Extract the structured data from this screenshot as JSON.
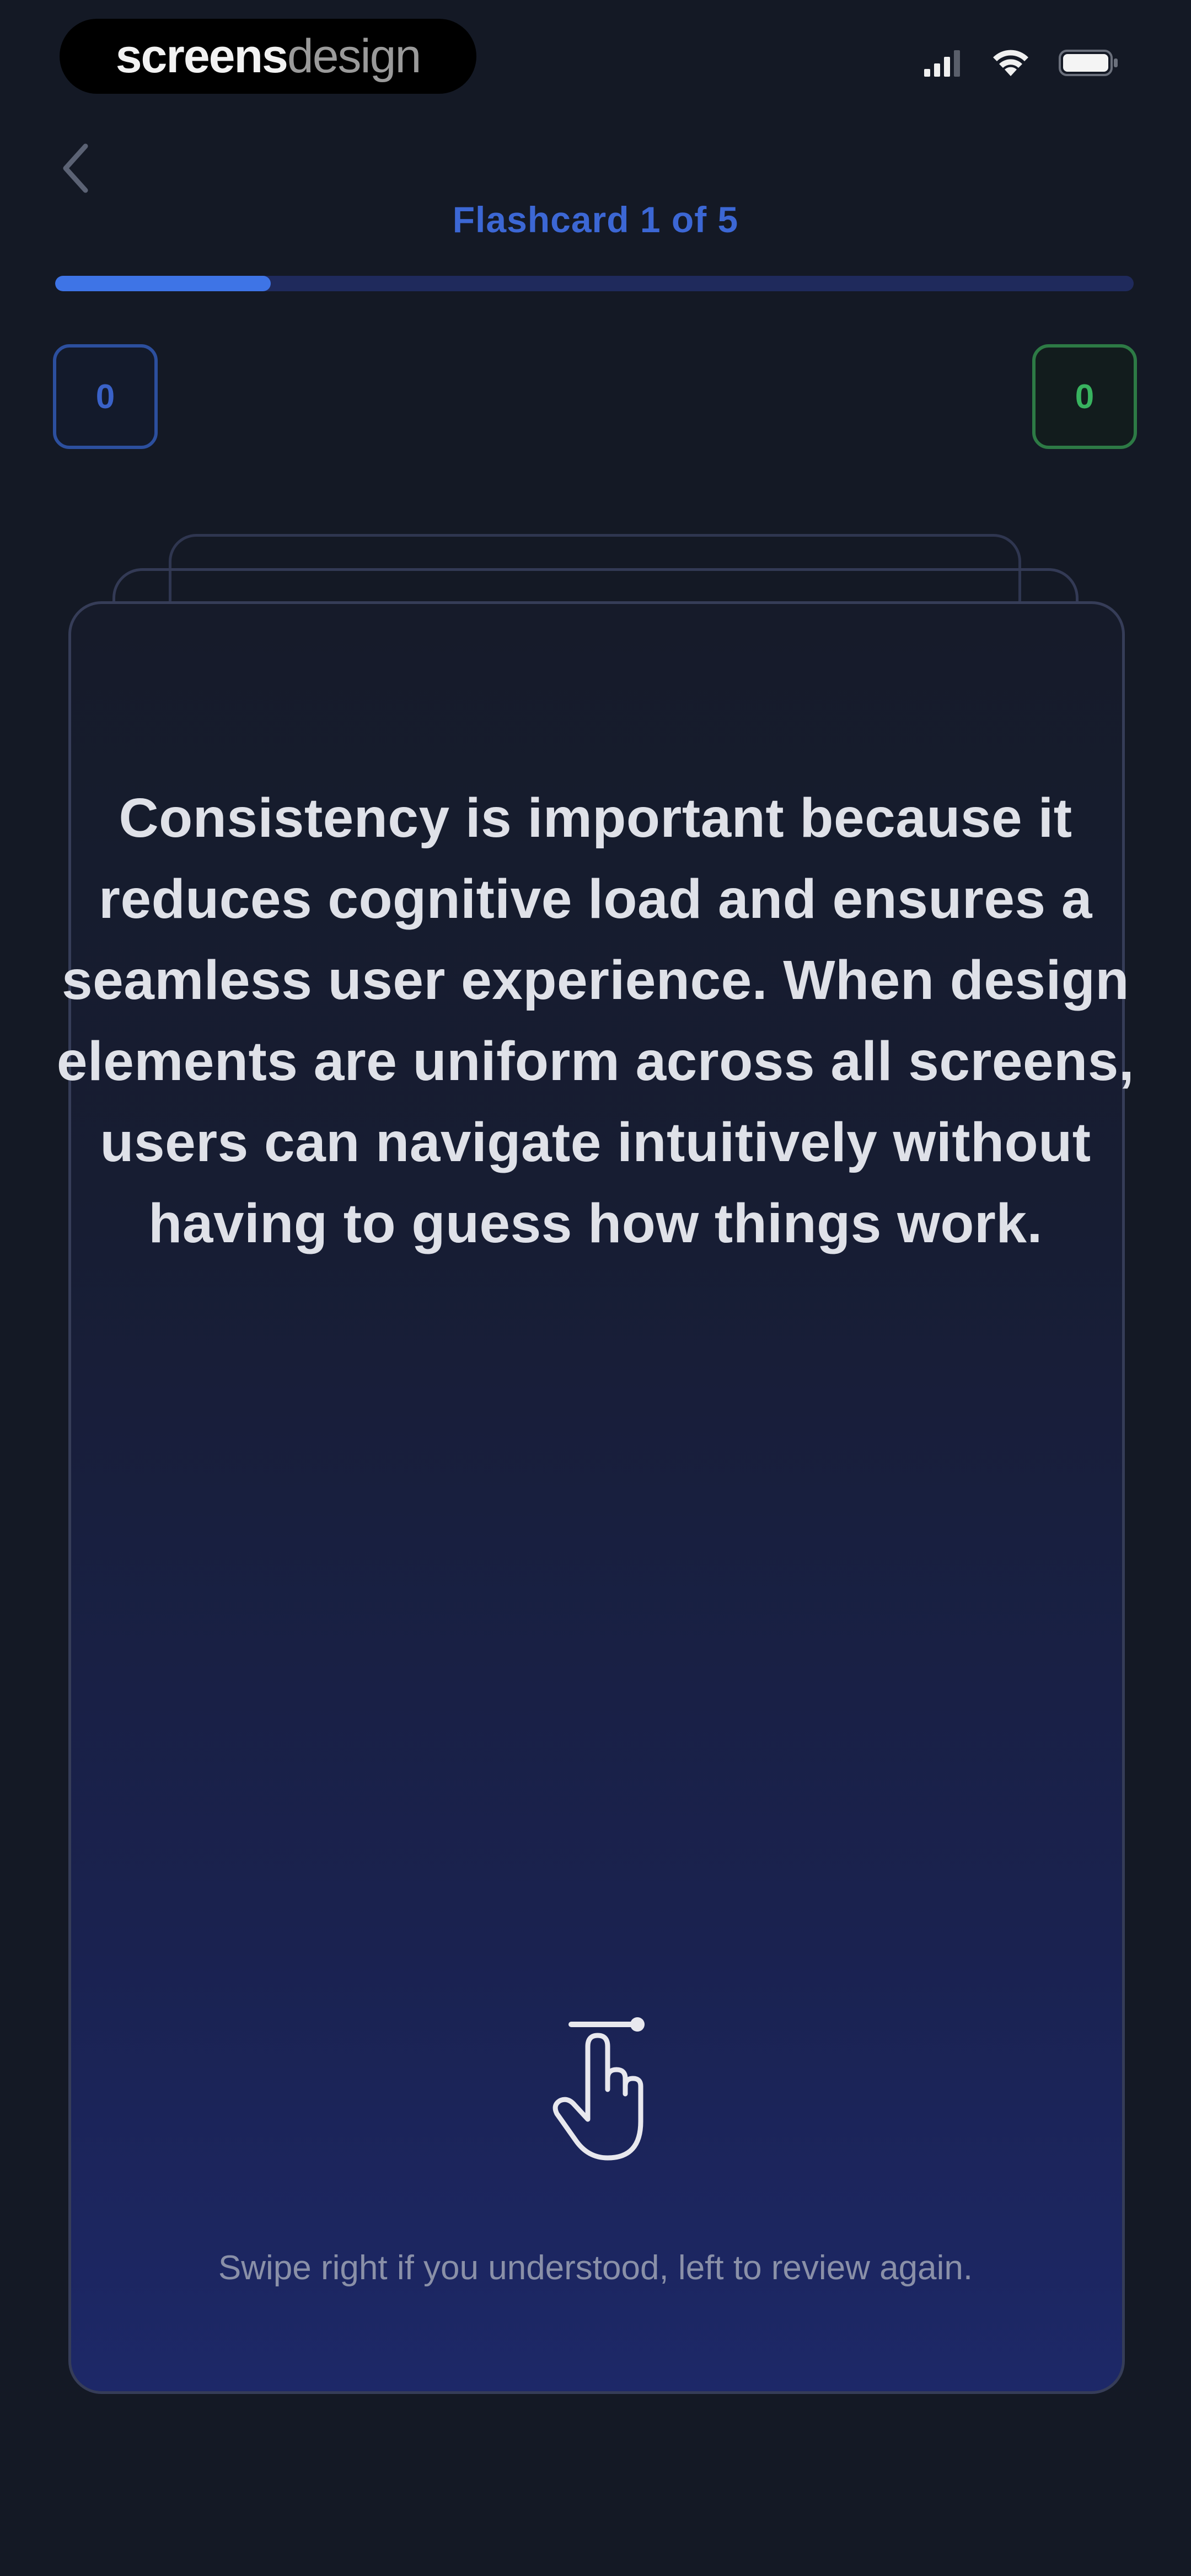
{
  "status_bar": {
    "brand_strong": "screens",
    "brand_light": "design",
    "signal_icon": "signal-icon",
    "wifi_icon": "wifi-icon",
    "battery_icon": "battery-icon"
  },
  "header": {
    "back_icon": "chevron-left-icon",
    "title": "Flashcard 1 of 5"
  },
  "progress": {
    "current": 1,
    "total": 5,
    "fraction": 0.2,
    "accent_color": "#3e74e6",
    "track_color": "#1f2a5c"
  },
  "counters": {
    "review": "0",
    "understood": "0",
    "review_color": "#3a62c8",
    "understood_color": "#38b35f"
  },
  "card": {
    "text": "Consistency is important because it reduces cognitive load and ensures a seamless user experience. When design elements are uniform across all screens, users can navigate intuitively without having to guess how things work.",
    "swipe_icon": "swipe-hand-icon",
    "hint": "Swipe right if you understood, left to review again."
  }
}
